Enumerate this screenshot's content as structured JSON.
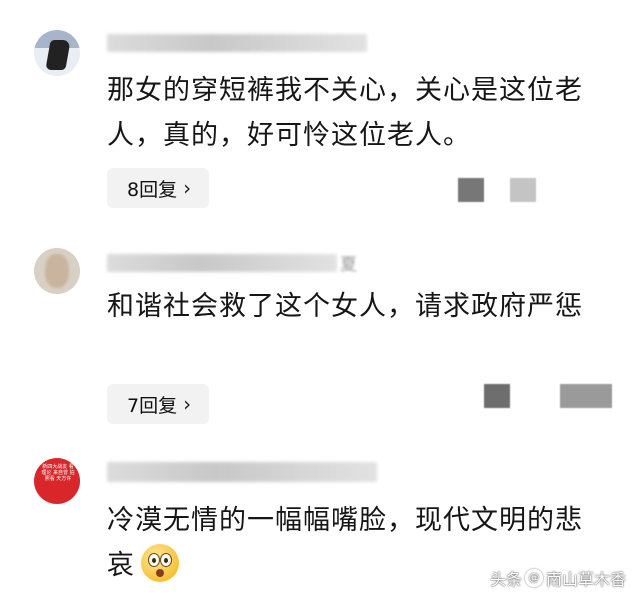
{
  "comments": [
    {
      "text": "那女的穿短裤我不关心，关心是这位老人，真的，好可怜这位老人。",
      "reply_label": "8回复",
      "reply_chevron": "chevron-right-icon"
    },
    {
      "text": "和谐社会救了这个女人，请求政府严惩",
      "reply_label": "7回复",
      "reply_chevron": "chevron-right-icon",
      "name_fragment": "夏"
    },
    {
      "text": "冷漠无情的一幅幅嘴脸，现代文明的悲哀",
      "emoji": "flushed-face-emoji",
      "avatar_text": "新四大战友 看理论 来自曾 拍照看 天方许"
    }
  ],
  "watermark": {
    "brand": "头条",
    "at": "@",
    "account": "南山草木香"
  }
}
